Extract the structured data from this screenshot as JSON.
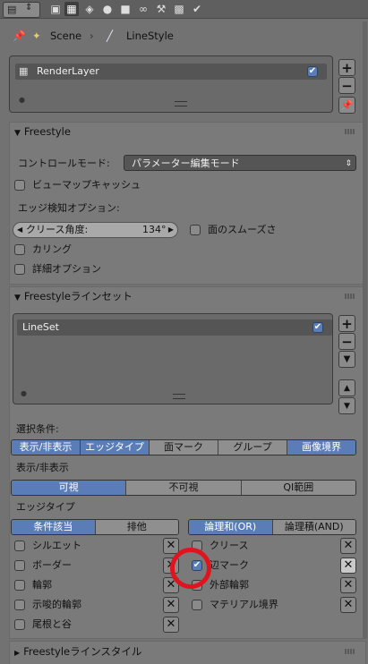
{
  "breadcrumb": {
    "scene": "Scene",
    "linestyle": "LineStyle"
  },
  "render_layers": {
    "item": "RenderLayer",
    "enabled": true
  },
  "freestyle": {
    "title": "Freestyle",
    "control_mode_label": "コントロールモード:",
    "control_mode_value": "パラメーター編集モード",
    "view_map_cache": "ビューマップキャッシュ",
    "edge_detection_label": "エッジ検知オプション:",
    "crease_angle_label": "クリース角度:",
    "crease_angle_value": "134°",
    "face_smoothness": "面のスムーズさ",
    "culling": "カリング",
    "advanced_options": "詳細オプション"
  },
  "lineset": {
    "title": "Freestyleラインセット",
    "item": "LineSet",
    "enabled": true,
    "selection_label": "選択条件:",
    "selection_tabs": [
      {
        "label": "表示/非表示",
        "on": true
      },
      {
        "label": "エッジタイプ",
        "on": true
      },
      {
        "label": "面マーク",
        "on": false
      },
      {
        "label": "グループ",
        "on": false
      },
      {
        "label": "画像境界",
        "on": true
      }
    ],
    "visibility_label": "表示/非表示",
    "visibility_tabs": [
      {
        "label": "可視",
        "on": true
      },
      {
        "label": "不可視",
        "on": false
      },
      {
        "label": "QI範囲",
        "on": false
      }
    ],
    "edge_types_label": "エッジタイプ",
    "inclusion_tabs": [
      {
        "label": "条件該当",
        "on": true
      },
      {
        "label": "排他",
        "on": false
      }
    ],
    "logic_tabs": [
      {
        "label": "論理和(OR)",
        "on": true
      },
      {
        "label": "論理積(AND)",
        "on": false
      }
    ],
    "edges_left": [
      "シルエット",
      "ボーダー",
      "輪郭",
      "示唆的輪郭",
      "尾根と谷"
    ],
    "edges_right": [
      "クリース",
      "辺マーク",
      "外部輪郭",
      "マテリアル境界"
    ],
    "edge_mark_checked": true
  },
  "linestyle_panel": {
    "title": "Freestyleラインスタイル"
  },
  "icons": {
    "pin": "pin-icon",
    "scene": "scene-icon",
    "linestyle": "brush-icon",
    "add": "plus-icon",
    "remove": "minus-icon",
    "close": "x-icon"
  },
  "colors": {
    "accent": "#5a7db8",
    "highlight": "#e0141e"
  }
}
